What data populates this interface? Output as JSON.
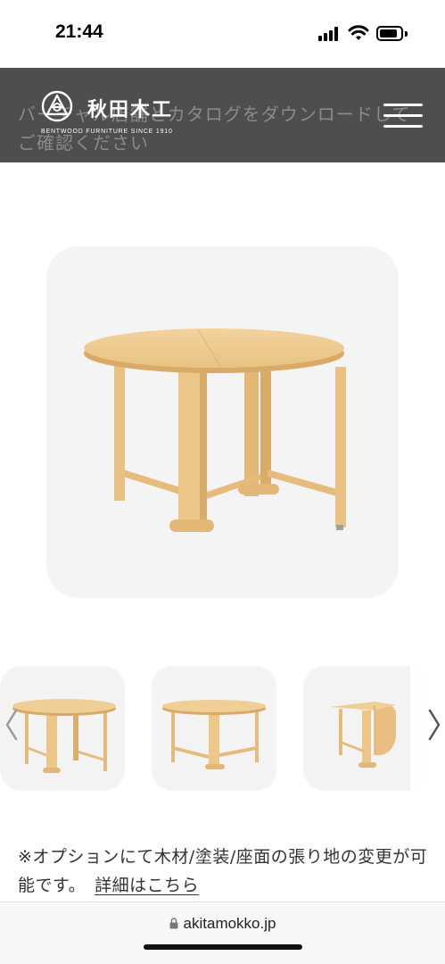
{
  "status_bar": {
    "time": "21:44"
  },
  "header": {
    "banner_text": "バーチャル店舗とカタログをダウンロードしてご確認ください",
    "logo_name": "秋田木工",
    "logo_subtitle": "BENTWOOD FURNITURE  SINCE 1910",
    "menu_icon": "hamburger-menu-icon"
  },
  "gallery": {
    "main_image": "oval-gateleg-table",
    "thumbnails": [
      "table-front-view",
      "table-side-view",
      "table-folded-leaf-view"
    ],
    "prev_icon": "chevron-left-icon",
    "next_icon": "chevron-right-icon"
  },
  "option_note": {
    "text": "※オプションにて木材/塗装/座面の張り地の変更が可能です。",
    "link": "詳細はこちら"
  },
  "browser": {
    "url": "akitamokko.jp",
    "lock_icon": "lock-icon"
  },
  "colors": {
    "header_bg": "#4e4e4e",
    "wood": "#e9c48a",
    "card_bg": "#f4f4f4"
  }
}
